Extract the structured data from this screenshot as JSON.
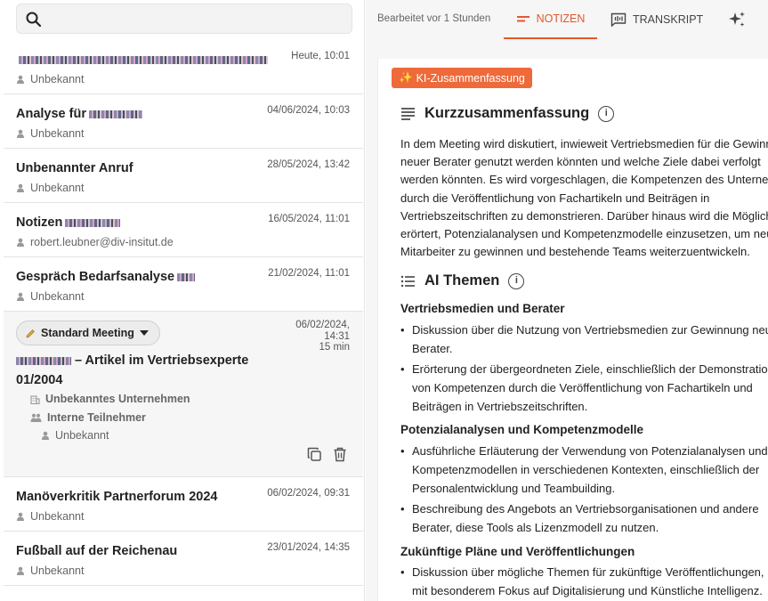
{
  "search": {
    "placeholder": ""
  },
  "meetings": [
    {
      "title": "",
      "time": "Heute, 10:01",
      "owner": "Unbekannt"
    },
    {
      "title": "Analyse für",
      "time": "04/06/2024, 10:03",
      "owner": "Unbekannt"
    },
    {
      "title": "Unbenannter Anruf",
      "time": "28/05/2024, 13:42",
      "owner": "Unbekannt"
    },
    {
      "title": "Notizen",
      "time": "16/05/2024, 11:01",
      "owner": "robert.leubner@div-insitut.de"
    },
    {
      "title": "Gespräch Bedarfsanalyse",
      "time": "21/02/2024, 11:01",
      "owner": "Unbekannt"
    }
  ],
  "selected": {
    "type_label": "Standard Meeting",
    "date": "06/02/2024,",
    "clock": "14:31",
    "duration": "15 min",
    "title_line1": "– Artikel im Vertriebsexperte",
    "title_line2": "01/2004",
    "company": "Unbekanntes Unternehmen",
    "participants": "Interne Teilnehmer",
    "participant": "Unbekannt"
  },
  "meetings_after": [
    {
      "title": "Manöverkritik Partnerforum 2024",
      "time": "06/02/2024, 09:31",
      "owner": "Unbekannt"
    },
    {
      "title": "Fußball auf der Reichenau",
      "time": "23/01/2024, 14:35",
      "owner": "Unbekannt"
    }
  ],
  "tabs": {
    "edited": "Bearbeitet vor 1 Stunden",
    "notes": "NOTIZEN",
    "transcript": "TRANSKRIPT"
  },
  "notes": {
    "ai_badge": "KI-Zusammenfassung",
    "summary_heading": "Kurzzusammenfassung",
    "summary_lines": [
      "In dem Meeting wird diskutiert, inwieweit Vertriebsmedien für die Gewinn",
      "neuer Berater genutzt werden könnten und welche Ziele dabei verfolgt",
      "werden könnten. Es wird vorgeschlagen, die Kompetenzen des Unternehm",
      "durch die Veröffentlichung von Fachartikeln und Beiträgen in",
      "Vertriebszeitschriften zu demonstrieren. Darüber hinaus wird die Möglich",
      "erörtert, Potenzialanalysen und Kompetenzmodelle einzusetzen, um neu",
      "Mitarbeiter zu gewinnen und bestehende Teams weiterzuentwickeln."
    ],
    "themes_heading": "AI Themen",
    "topics": [
      {
        "title": "Vertriebsmedien und Berater",
        "bullets": [
          [
            "Diskussion über die Nutzung von Vertriebsmedien zur Gewinnung neu",
            "Berater."
          ],
          [
            "Erörterung der übergeordneten Ziele, einschließlich der Demonstration",
            "von Kompetenzen durch die Veröffentlichung von Fachartikeln und",
            "Beiträgen in Vertriebszeitschriften."
          ]
        ]
      },
      {
        "title": "Potenzialanalysen und Kompetenzmodelle",
        "bullets": [
          [
            "Ausführliche Erläuterung der Verwendung von Potenzialanalysen und",
            "Kompetenzmodellen in verschiedenen Kontexten, einschließlich der",
            "Personalentwicklung und Teambuilding."
          ],
          [
            "Beschreibung des Angebots an Vertriebsorganisationen und andere",
            "Berater, diese Tools als Lizenzmodell zu nutzen."
          ]
        ]
      },
      {
        "title": "Zukünftige Pläne und Veröffentlichungen",
        "bullets": [
          [
            "Diskussion über mögliche Themen für zukünftige Veröffentlichungen,",
            "mit besonderem Fokus auf Digitalisierung und Künstliche Intelligenz."
          ]
        ]
      }
    ]
  },
  "colors": {
    "accent": "#e4572e",
    "badge": "#ee6a3a"
  },
  "icons": [
    "search-icon",
    "person-icon",
    "pencil-icon",
    "chevron-down-icon",
    "building-icon",
    "group-icon",
    "copy-icon",
    "trash-icon",
    "notes-icon",
    "transcript-icon",
    "sparkle-icon",
    "info-icon",
    "list-icon"
  ]
}
